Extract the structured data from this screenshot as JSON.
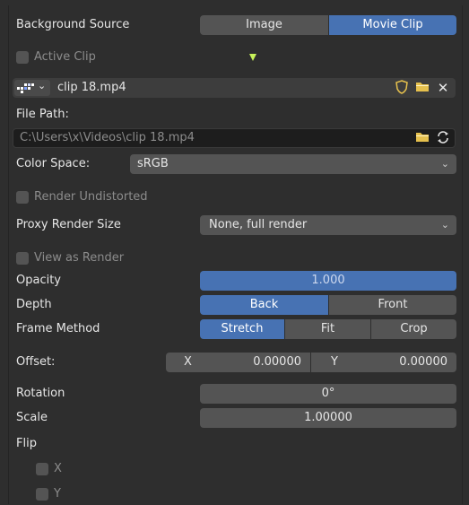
{
  "background_source": {
    "label": "Background Source",
    "options": [
      "Image",
      "Movie Clip"
    ],
    "selected": "Movie Clip"
  },
  "active_clip": {
    "label": "Active Clip",
    "checked": false
  },
  "clip": {
    "name": "clip 18.mp4"
  },
  "file_path": {
    "label": "File Path:",
    "value": "C:\\Users\\x\\Videos\\clip 18.mp4"
  },
  "color_space": {
    "label": "Color Space:",
    "value": "sRGB"
  },
  "render_undistorted": {
    "label": "Render Undistorted",
    "checked": false
  },
  "proxy_render_size": {
    "label": "Proxy Render Size",
    "value": "None, full render"
  },
  "view_as_render": {
    "label": "View as Render",
    "checked": false
  },
  "opacity": {
    "label": "Opacity",
    "value": "1.000",
    "fraction": 1.0
  },
  "depth": {
    "label": "Depth",
    "options": [
      "Back",
      "Front"
    ],
    "selected": "Back"
  },
  "frame_method": {
    "label": "Frame Method",
    "options": [
      "Stretch",
      "Fit",
      "Crop"
    ],
    "selected": "Stretch"
  },
  "offset": {
    "label": "Offset:",
    "x_label": "X",
    "x_value": "0.00000",
    "y_label": "Y",
    "y_value": "0.00000"
  },
  "rotation": {
    "label": "Rotation",
    "value": "0°"
  },
  "scale": {
    "label": "Scale",
    "value": "1.00000"
  },
  "flip": {
    "label": "Flip",
    "x_label": "X",
    "y_label": "Y",
    "x_checked": false,
    "y_checked": false
  },
  "colors": {
    "accent": "#4772b3",
    "widget": "#545454",
    "background": "#2e2e2e",
    "field_dark": "#1d1d1d",
    "folder": "#e5c04d",
    "triangle": "#c8f25a"
  }
}
